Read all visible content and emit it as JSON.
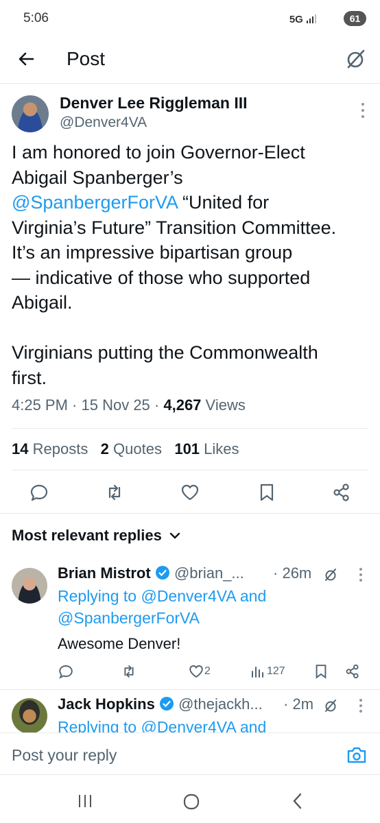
{
  "status_bar": {
    "time": "5:06",
    "network": "5G",
    "battery": "61"
  },
  "header": {
    "title": "Post",
    "back_icon": "arrow-left-icon",
    "grok_icon": "grok-icon"
  },
  "post": {
    "author_name": "Denver Lee Riggleman III",
    "author_handle": "@Denver4VA",
    "text_part1": "I am honored to join Governor-Elect\nAbigail Spanberger’s\n",
    "mention": "@SpanbergerForVA",
    "text_part2": " “United for\nVirginia’s Future” Transition Committee.\nIt’s an impressive bipartisan group\n— indicative of those who supported\nAbigail.\n\nVirginians putting the Commonwealth\nfirst.",
    "time": "4:25 PM",
    "date": "15 Nov 25",
    "views_count": "4,267",
    "views_label": "Views",
    "reposts_count": "14",
    "reposts_label": "Reposts",
    "quotes_count": "2",
    "quotes_label": "Quotes",
    "likes_count": "101",
    "likes_label": "Likes"
  },
  "replies_heading": "Most relevant replies",
  "replies": [
    {
      "name": "Brian Mistrot",
      "handle": "@brian_...",
      "time": "26m",
      "replying_prefix": "Replying to ",
      "replying_to_1": "@Denver4VA",
      "replying_and": " and",
      "replying_to_2": "@SpanbergerForVA",
      "text": "Awesome Denver!",
      "likes": "2",
      "views": "127"
    },
    {
      "name": "Jack Hopkins",
      "handle": "@thejackh...",
      "time": "2m",
      "replying_prefix": "Replying to ",
      "replying_to_1": "@Denver4VA",
      "replying_and": " and"
    }
  ],
  "reply_box": {
    "placeholder": "Post your reply"
  },
  "colors": {
    "accent": "#1d9bf0",
    "text": "#0f1419",
    "secondary": "#536471",
    "verified": "#1d9bf0"
  }
}
